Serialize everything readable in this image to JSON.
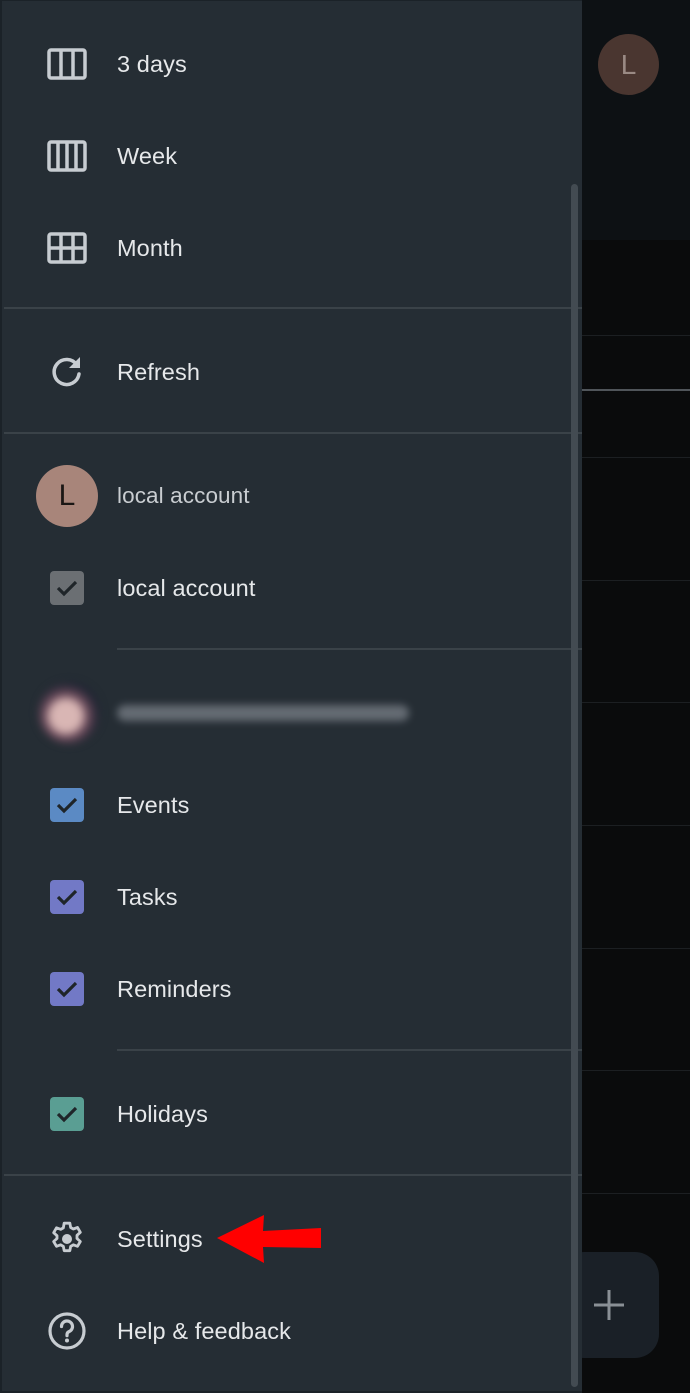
{
  "background": {
    "account_avatar_letter": "L",
    "fab_icon": "plus-icon"
  },
  "drawer": {
    "view_options": [
      {
        "label": "3 days",
        "icon": "three-day-view-icon"
      },
      {
        "label": "Week",
        "icon": "week-view-icon"
      },
      {
        "label": "Month",
        "icon": "month-view-icon"
      }
    ],
    "refresh": {
      "label": "Refresh",
      "icon": "refresh-icon"
    },
    "accounts": [
      {
        "name": "local account",
        "avatar_letter": "L",
        "avatar_color": "#a8857a",
        "calendars": [
          {
            "label": "local account",
            "checked": true,
            "color": "#6b6f73"
          }
        ]
      },
      {
        "name": "[email blurred]",
        "avatar": "profile-photo (blurred)",
        "calendars": [
          {
            "label": "Events",
            "checked": true,
            "color": "#5b8ac4"
          },
          {
            "label": "Tasks",
            "checked": true,
            "color": "#7279c6"
          },
          {
            "label": "Reminders",
            "checked": true,
            "color": "#7279c6"
          }
        ]
      }
    ],
    "other_calendars": [
      {
        "label": "Holidays",
        "checked": true,
        "color": "#5a9e93"
      }
    ],
    "footer": [
      {
        "label": "Settings",
        "icon": "settings-gear-icon"
      },
      {
        "label": "Help & feedback",
        "icon": "help-icon"
      }
    ]
  },
  "annotation": {
    "type": "red-arrow",
    "points_to": "Settings",
    "color": "#ff0000"
  }
}
